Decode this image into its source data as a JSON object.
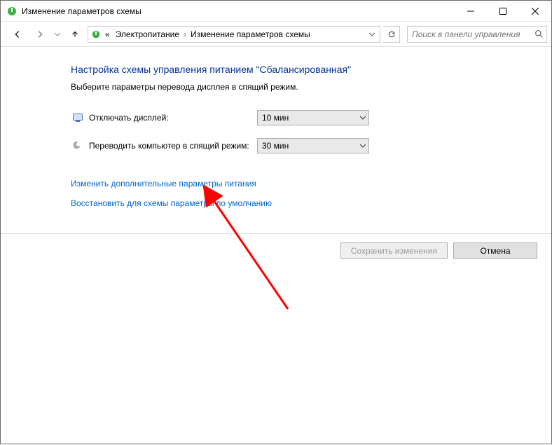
{
  "window": {
    "title": "Изменение параметров схемы"
  },
  "breadcrumb": {
    "prefix": "«",
    "seg1": "Электропитание",
    "seg2": "Изменение параметров схемы"
  },
  "search": {
    "placeholder": "Поиск в панели управления"
  },
  "page": {
    "heading": "Настройка схемы управления питанием \"Сбалансированная\"",
    "sub": "Выберите параметры перевода дисплея в спящий режим."
  },
  "settings": {
    "display_off_label": "Отключать дисплей:",
    "display_off_value": "10 мин",
    "sleep_label": "Переводить компьютер в спящий режим:",
    "sleep_value": "30 мин"
  },
  "links": {
    "advanced": "Изменить дополнительные параметры питания",
    "restore_defaults": "Восстановить для схемы параметры по умолчанию"
  },
  "buttons": {
    "save": "Сохранить изменения",
    "cancel": "Отмена"
  }
}
